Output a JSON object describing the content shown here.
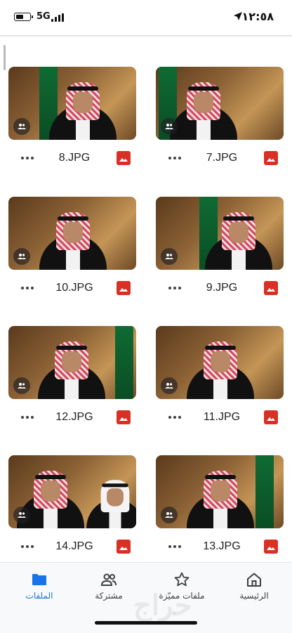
{
  "status_bar": {
    "time": "١٢:٥٨",
    "network": "5G"
  },
  "files": [
    {
      "name": "8.JPG",
      "type_icon": "image-file-icon",
      "shared": true
    },
    {
      "name": "7.JPG",
      "type_icon": "image-file-icon",
      "shared": true
    },
    {
      "name": "10.JPG",
      "type_icon": "image-file-icon",
      "shared": true
    },
    {
      "name": "9.JPG",
      "type_icon": "image-file-icon",
      "shared": true
    },
    {
      "name": "12.JPG",
      "type_icon": "image-file-icon",
      "shared": true
    },
    {
      "name": "11.JPG",
      "type_icon": "image-file-icon",
      "shared": true
    },
    {
      "name": "14.JPG",
      "type_icon": "image-file-icon",
      "shared": true
    },
    {
      "name": "13.JPG",
      "type_icon": "image-file-icon",
      "shared": true
    }
  ],
  "bottom_nav": {
    "items": [
      {
        "label": "الملفات",
        "icon": "folder-icon",
        "active": true
      },
      {
        "label": "مشتركة",
        "icon": "people-icon",
        "active": false
      },
      {
        "label": "ملفات مميّزة",
        "icon": "star-icon",
        "active": false
      },
      {
        "label": "الرئيسية",
        "icon": "home-icon",
        "active": false
      }
    ]
  },
  "watermark": "حراج",
  "colors": {
    "accent": "#1a73e8",
    "image_type": "#d93025",
    "nav_background": "#f8f9fa"
  }
}
